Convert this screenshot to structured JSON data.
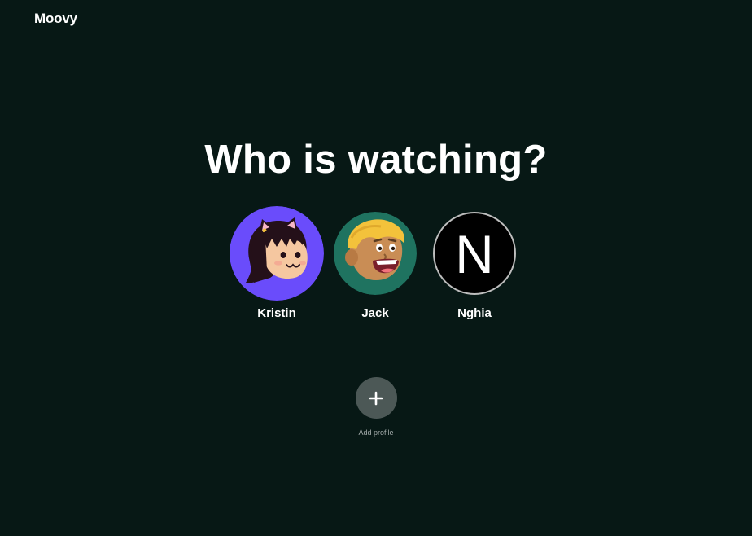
{
  "app": {
    "logo_text": "Moovy"
  },
  "main": {
    "headline": "Who is watching?",
    "profiles": [
      {
        "name": "Kristin",
        "avatar_icon": "girl-cat-ears-avatar",
        "avatar_bg": "#6a4cfb"
      },
      {
        "name": "Jack",
        "avatar_icon": "blond-boy-avatar",
        "avatar_bg": "#1f7360"
      },
      {
        "name": "Nghia",
        "avatar_initial": "N",
        "avatar_bg": "#000000"
      }
    ],
    "add_profile": {
      "icon": "plus-icon",
      "label": "Add profile"
    }
  },
  "colors": {
    "background": "#071815",
    "text": "#ffffff",
    "add_button_bg": "#4c5856",
    "muted_text": "#a3abaa"
  }
}
